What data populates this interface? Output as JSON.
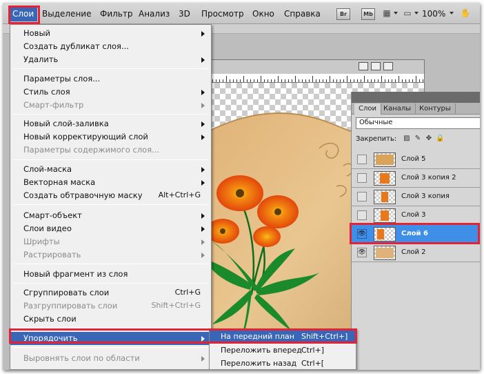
{
  "menubar": {
    "items": [
      "Слои",
      "Выделение",
      "Фильтр",
      "Анализ",
      "3D",
      "Просмотр",
      "Окно",
      "Справка"
    ],
    "bridge_buttons": [
      "Br",
      "Mb"
    ],
    "zoom": "100%"
  },
  "layer_menu": {
    "items": [
      {
        "label": "Новый",
        "shortcut": "",
        "submenu": true,
        "disabled": false
      },
      {
        "label": "Создать дубликат слоя...",
        "shortcut": "",
        "submenu": false,
        "disabled": false
      },
      {
        "label": "Удалить",
        "shortcut": "",
        "submenu": true,
        "disabled": false
      },
      {
        "label": "Параметры слоя...",
        "shortcut": "",
        "submenu": false,
        "disabled": false
      },
      {
        "label": "Стиль слоя",
        "shortcut": "",
        "submenu": true,
        "disabled": false
      },
      {
        "label": "Смарт-фильтр",
        "shortcut": "",
        "submenu": true,
        "disabled": true
      },
      {
        "label": "Новый слой-заливка",
        "shortcut": "",
        "submenu": true,
        "disabled": false
      },
      {
        "label": "Новый корректирующий слой",
        "shortcut": "",
        "submenu": true,
        "disabled": false
      },
      {
        "label": "Параметры содержимого слоя...",
        "shortcut": "",
        "submenu": false,
        "disabled": true
      },
      {
        "label": "Слой-маска",
        "shortcut": "",
        "submenu": true,
        "disabled": false
      },
      {
        "label": "Векторная маска",
        "shortcut": "",
        "submenu": true,
        "disabled": false
      },
      {
        "label": "Создать обтравочную маску",
        "shortcut": "Alt+Ctrl+G",
        "submenu": false,
        "disabled": false
      },
      {
        "label": "Смарт-объект",
        "shortcut": "",
        "submenu": true,
        "disabled": false
      },
      {
        "label": "Слои видео",
        "shortcut": "",
        "submenu": true,
        "disabled": false
      },
      {
        "label": "Шрифты",
        "shortcut": "",
        "submenu": true,
        "disabled": true
      },
      {
        "label": "Растрировать",
        "shortcut": "",
        "submenu": true,
        "disabled": true
      },
      {
        "label": "Новый фрагмент из слоя",
        "shortcut": "",
        "submenu": false,
        "disabled": false
      },
      {
        "label": "Сгруппировать слои",
        "shortcut": "Ctrl+G",
        "submenu": false,
        "disabled": false
      },
      {
        "label": "Разгруппировать слои",
        "shortcut": "Shift+Ctrl+G",
        "submenu": false,
        "disabled": true
      },
      {
        "label": "Скрыть слои",
        "shortcut": "",
        "submenu": false,
        "disabled": false
      },
      {
        "label": "Упорядочить",
        "shortcut": "",
        "submenu": true,
        "disabled": false,
        "highlighted": true
      },
      {
        "label": "Выровнять слои по области",
        "shortcut": "",
        "submenu": true,
        "disabled": true
      }
    ]
  },
  "arrange_submenu": {
    "items": [
      {
        "label": "На передний план",
        "shortcut": "Shift+Ctrl+]",
        "highlighted": true
      },
      {
        "label": "Переложить вперед",
        "shortcut": "Ctrl+]",
        "highlighted": false
      },
      {
        "label": "Переложить назад",
        "shortcut": "Ctrl+[",
        "highlighted": false
      }
    ]
  },
  "layers_panel": {
    "tabs": [
      "Слои",
      "Каналы",
      "Контуры"
    ],
    "blend_mode": "Обычные",
    "lock_label": "Закрепить:",
    "layers": [
      {
        "name": "Слой 5",
        "visible": false,
        "selected": false
      },
      {
        "name": "Слой 3 копия 2",
        "visible": false,
        "selected": false
      },
      {
        "name": "Слой 3 копия",
        "visible": false,
        "selected": false
      },
      {
        "name": "Слой 3",
        "visible": false,
        "selected": false
      },
      {
        "name": "Слой 6",
        "visible": true,
        "selected": true
      },
      {
        "name": "Слой 2",
        "visible": true,
        "selected": false
      }
    ]
  },
  "colors": {
    "highlight": "#3a66b8",
    "selected_layer": "#3f8ee8",
    "annotation_red": "#e52234"
  }
}
